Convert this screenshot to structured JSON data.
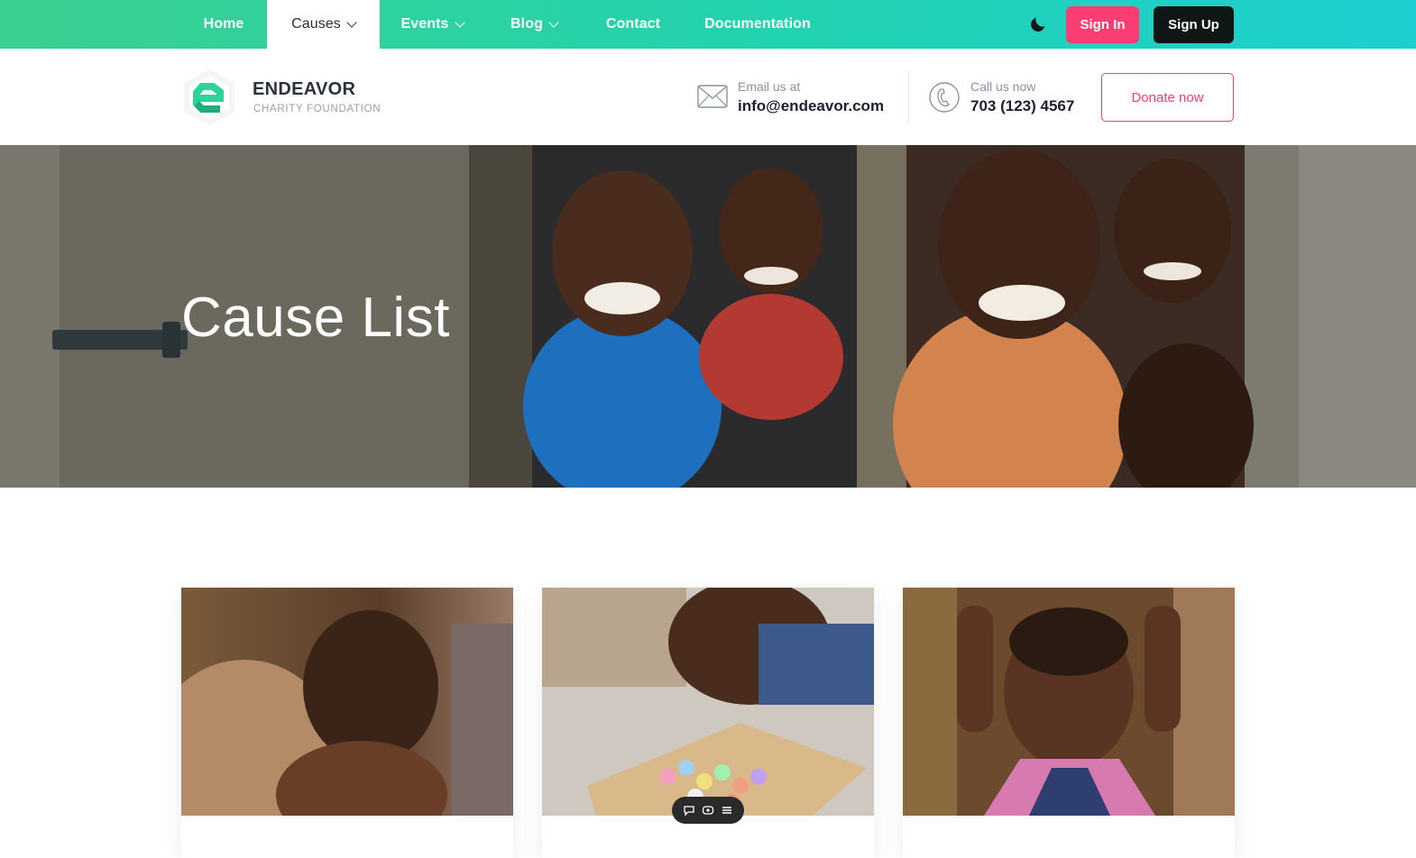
{
  "topnav": {
    "items": [
      {
        "label": "Home"
      },
      {
        "label": "Causes"
      },
      {
        "label": "Events"
      },
      {
        "label": "Blog"
      },
      {
        "label": "Contact"
      },
      {
        "label": "Documentation"
      }
    ],
    "active": "Causes",
    "signin_label": "Sign In",
    "signup_label": "Sign Up",
    "icons": [
      "moon-icon",
      "chevron-down-icon"
    ]
  },
  "brand": {
    "name": "ENDEAVOR",
    "tagline": "CHARITY FOUNDATION"
  },
  "contact": {
    "email_label": "Email us at",
    "email_value": "info@endeavor.com",
    "phone_label": "Call us now",
    "phone_value": "703 (123) 4567",
    "icons": [
      "mail-icon",
      "phone-icon"
    ]
  },
  "donate_label": "Donate now",
  "hero": {
    "title": "Cause List"
  },
  "cards": [
    {
      "image": "child-hugging-photo"
    },
    {
      "image": "chalk-box-photo"
    },
    {
      "image": "boy-portrait-photo"
    }
  ],
  "floating_toolbar": {
    "icons": [
      "comment-icon",
      "eye-icon",
      "menu-icon"
    ]
  },
  "colors": {
    "nav_gradient_start": "#3ad08f",
    "nav_gradient_end": "#1ccfd0",
    "accent_pink": "#fb3d74",
    "dark_button": "#0e1715",
    "logo_green": "#2ed39a"
  }
}
